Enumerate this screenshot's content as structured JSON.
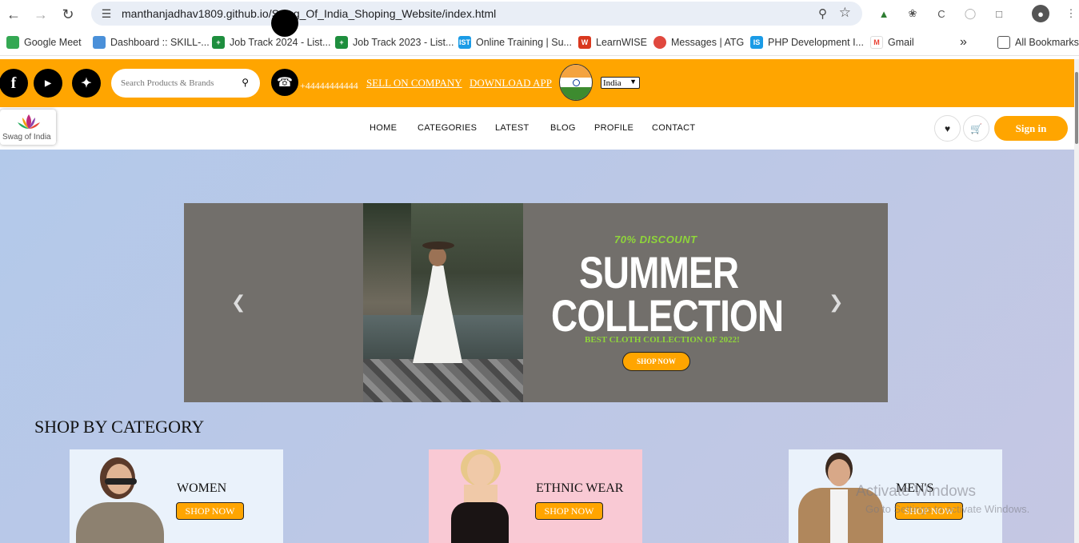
{
  "browser": {
    "url": "manthanjadhav1809.github.io/Swag_Of_India_Shoping_Website/index.html",
    "bookmarks": [
      {
        "label": "Google Meet",
        "color": "#34a853"
      },
      {
        "label": "Dashboard :: SKILL-...",
        "color": "#4a90d9"
      },
      {
        "label": "Job Track 2024 - List...",
        "color": "#1e8e3e"
      },
      {
        "label": "Job Track 2023 - List...",
        "color": "#1e8e3e"
      },
      {
        "label": "Online Training | Su...",
        "color": "#1a9be6"
      },
      {
        "label": "LearnWISE",
        "color": "#d9381e"
      },
      {
        "label": "Messages | ATG",
        "color": "#e0483e"
      },
      {
        "label": "PHP Development I...",
        "color": "#1a9be6"
      },
      {
        "label": "Gmail",
        "color": "#ea4335"
      }
    ],
    "all_bookmarks": "All Bookmarks",
    "more": "»"
  },
  "topbar": {
    "search_placeholder": "Search Products & Brands",
    "phone": "+44444444444",
    "sell_link": "SELL ON COMPANY",
    "download_link": "DOWNLOAD APP",
    "country": "India",
    "background": "#ffa500"
  },
  "nav": {
    "logo_text": "Swag of India",
    "items": [
      "HOME",
      "CATEGORIES",
      "LATEST",
      "BLOG",
      "PROFILE",
      "CONTACT"
    ],
    "signin": "Sign in"
  },
  "hero": {
    "discount": "70% DISCOUNT",
    "title_line1": "SUMMER",
    "title_line2": "COLLECTION",
    "tagline": "BEST CLOTH COLLECTION OF 2022!",
    "cta": "SHOP NOW"
  },
  "categories": {
    "title": "SHOP BY CATEGORY",
    "cards": [
      {
        "label": "WOMEN",
        "cta": "SHOP NOW",
        "bg": "#eaf2fb"
      },
      {
        "label": "ETHNIC WEAR",
        "cta": "SHOP NOW",
        "bg": "#f9c9d4"
      },
      {
        "label": "MEN'S",
        "cta": "SHOP NOW",
        "bg": "#eaf2fb"
      }
    ]
  },
  "watermark": {
    "line1": "Activate Windows",
    "line2": "Go to Settings to activate Windows."
  }
}
